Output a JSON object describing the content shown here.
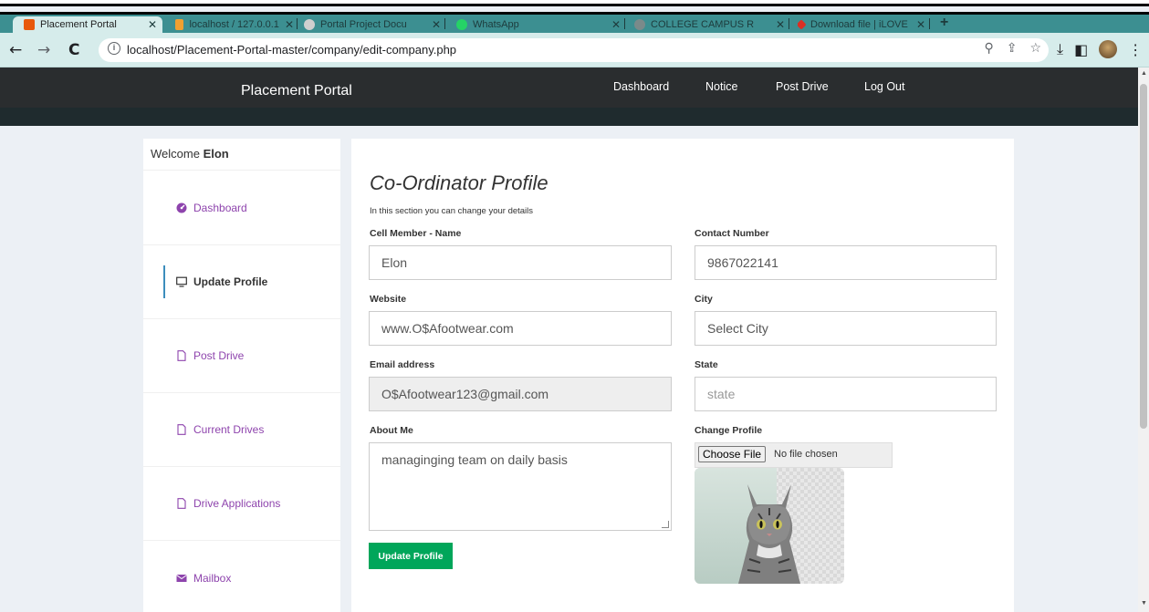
{
  "browser": {
    "tabs": [
      {
        "label": "Placement Portal"
      },
      {
        "label": "localhost / 127.0.0.1"
      },
      {
        "label": "Portal Project Docu"
      },
      {
        "label": "WhatsApp"
      },
      {
        "label": "COLLEGE CAMPUS R"
      },
      {
        "label": "Download file | iLOVE"
      }
    ],
    "url": "localhost/Placement-Portal-master/company/edit-company.php"
  },
  "navbar": {
    "brand": "Placement Portal",
    "links": [
      "Dashboard",
      "Notice",
      "Post Drive",
      "Log Out"
    ]
  },
  "sidebar": {
    "welcome_prefix": "Welcome",
    "welcome_name": "Elon",
    "items": [
      {
        "label": "Dashboard",
        "icon": "dashboard-icon"
      },
      {
        "label": "Update Profile",
        "icon": "monitor-icon"
      },
      {
        "label": "Post Drive",
        "icon": "file-icon"
      },
      {
        "label": "Current Drives",
        "icon": "file-icon"
      },
      {
        "label": "Drive Applications",
        "icon": "file-icon"
      },
      {
        "label": "Mailbox",
        "icon": "envelope-icon"
      }
    ]
  },
  "main": {
    "title": "Co-Ordinator Profile",
    "subtitle": "In this section you can change your details",
    "fields": {
      "name_label": "Cell Member - Name",
      "name_value": "Elon",
      "contact_label": "Contact Number",
      "contact_value": "9867022141",
      "website_label": "Website",
      "website_value": "www.O$Afootwear.com",
      "city_label": "City",
      "city_value": "Select City",
      "email_label": "Email address",
      "email_value": "O$Afootwear123@gmail.com",
      "state_label": "State",
      "state_placeholder": "state",
      "about_label": "About Me",
      "about_value": "managinging team on daily basis",
      "change_profile_label": "Change Profile",
      "choose_file": "Choose File",
      "no_file": "No file chosen"
    },
    "update_button": "Update Profile"
  }
}
